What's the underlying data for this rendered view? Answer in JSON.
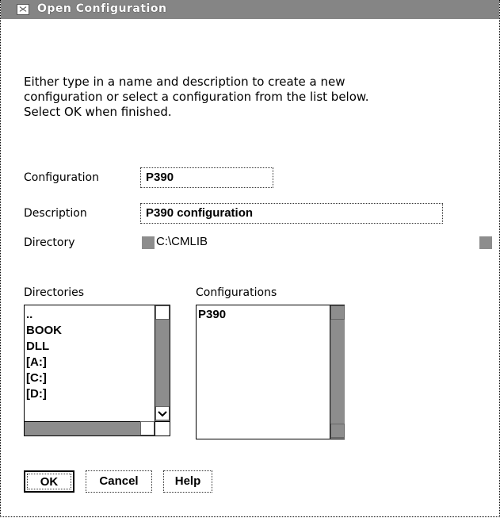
{
  "window": {
    "title": "Open Configuration"
  },
  "instructions": "Either type in a name and description to create a new\nconfiguration or select a configuration from the list below.\nSelect OK when finished.",
  "form": {
    "configuration_label": "Configuration",
    "configuration_value": "P390",
    "description_label": "Description",
    "description_value": "P390 configuration",
    "directory_label": "Directory",
    "directory_value": "C:\\CMLIB"
  },
  "directories": {
    "label": "Directories",
    "items": [
      "..",
      "BOOK",
      "DLL",
      "[A:]",
      "[C:]",
      "[D:]"
    ]
  },
  "configurations": {
    "label": "Configurations",
    "items": [
      "P390"
    ]
  },
  "buttons": {
    "ok": "OK",
    "cancel": "Cancel",
    "help": "Help"
  },
  "icons": [
    "system-menu-icon",
    "scroll-up-icon",
    "scroll-down-icon",
    "scroll-right-icon"
  ]
}
